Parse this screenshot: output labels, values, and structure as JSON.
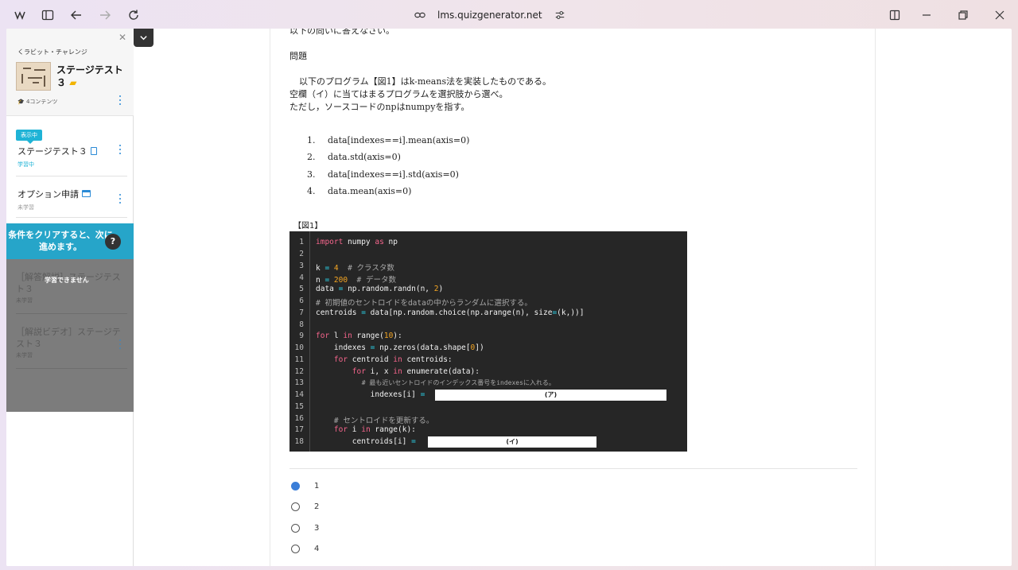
{
  "browser": {
    "url": "lms.quizgenerator.net"
  },
  "sidebar": {
    "back_label": "くラビット・チャレンジ",
    "course_title": "ステージテスト３",
    "content_count": "4コンテンツ",
    "current_badge": "表示中",
    "items": [
      {
        "title": "ステージテスト３",
        "status": "学習中",
        "status_color": "#1fb3d6"
      },
      {
        "title": "オプション申請",
        "status": "未学習",
        "status_color": "#999999"
      }
    ],
    "lock_message": "条件をクリアすると、次に進めます。",
    "lock_help": "?",
    "cannot_study": "学習できません",
    "locked_items": [
      {
        "title": "［解答解説］ステージテスト３",
        "status": "未学習"
      },
      {
        "title": "［解説ビデオ］ステージテスト３",
        "status": "未学習"
      }
    ]
  },
  "question": {
    "intro_cut": "以下の問いに答えなさい。",
    "heading": "問題",
    "line1": "以下のプログラム【図1】はk-means法を実装したものである。",
    "line2": "空欄（イ）に当てはまるプログラムを選択肢から選べ。",
    "line3": "ただし，ソースコードのnpはnumpyを指す。",
    "choices": [
      {
        "num": "1.",
        "text": "data[indexes==i].mean(axis=0)"
      },
      {
        "num": "2.",
        "text": "data.std(axis=0)"
      },
      {
        "num": "3.",
        "text": "data[indexes==i].std(axis=0)"
      },
      {
        "num": "4.",
        "text": "data.mean(axis=0)"
      }
    ],
    "figure_label": "【図1】",
    "code_lines": [
      "1",
      "2",
      "3",
      "4",
      "5",
      "6",
      "7",
      "8",
      "9",
      "10",
      "11",
      "12",
      "13",
      "14",
      "15",
      "16",
      "17",
      "18"
    ],
    "blank_a": "(ア)",
    "blank_i": "(イ)",
    "answer_options": [
      "1",
      "2",
      "3",
      "4"
    ],
    "selected_option": "1"
  }
}
